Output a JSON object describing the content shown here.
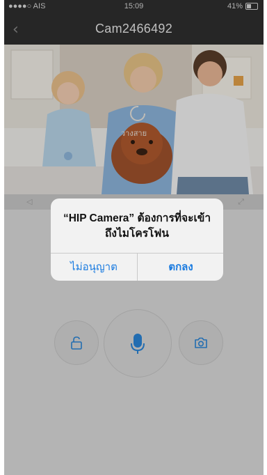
{
  "status_bar": {
    "carrier": "●●●●○ AIS",
    "wifi": "wifi-icon",
    "time": "15:09",
    "battery_percent": "41%",
    "battery_level": 0.41
  },
  "nav": {
    "back_icon": "chevron-left-icon",
    "title": "Cam2466492"
  },
  "video": {
    "overlay_text": "วางสาย"
  },
  "alert": {
    "message": "“HIP Camera” ต้องการที่จะเข้าถึงไมโครโฟน",
    "deny_label": "ไม่อนุญาต",
    "ok_label": "ตกลง",
    "accent": "#1a7be0"
  },
  "controls": {
    "lock_icon": "unlock-icon",
    "mic_icon": "microphone-icon",
    "camera_icon": "camera-icon",
    "icon_color": "#2a86d8"
  }
}
